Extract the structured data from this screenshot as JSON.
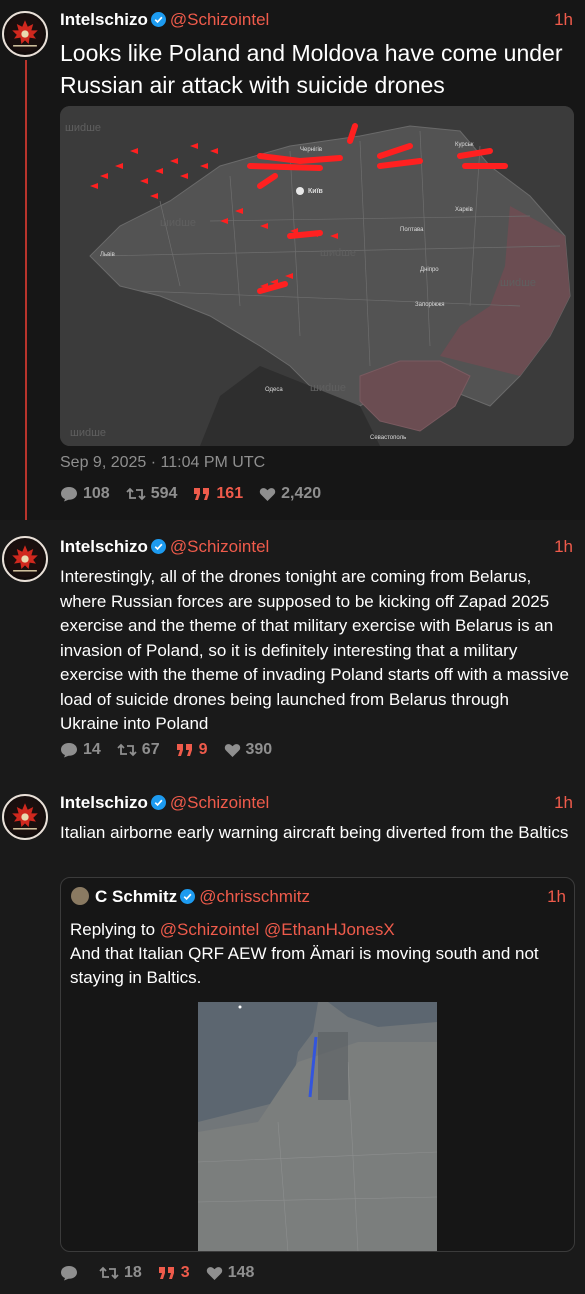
{
  "tweets": [
    {
      "author": "Intelschizo",
      "handle": "@Schizointel",
      "time": "1h",
      "text": "Looks like Poland and Moldova have come under Russian air attack with suicide drones",
      "date": "Sep 9, 2025 · 11:04 PM UTC",
      "replies": "108",
      "retweets": "594",
      "quotes": "161",
      "likes": "2,420"
    },
    {
      "author": "Intelschizo",
      "handle": "@Schizointel",
      "time": "1h",
      "text": "Interestingly, all of the drones tonight are coming from Belarus, where Russian forces are supposed to be kicking off Zapad 2025 exercise and the theme of that military exercise with Belarus is an invasion of Poland, so it is definitely interesting that a military exercise with the theme of invading Poland starts off with a massive load of suicide drones being launched from Belarus through Ukraine into Poland",
      "replies": "14",
      "retweets": "67",
      "quotes": "9",
      "likes": "390"
    },
    {
      "author": "Intelschizo",
      "handle": "@Schizointel",
      "time": "1h",
      "text": "Italian airborne early warning aircraft being diverted from the Baltics",
      "replies": "",
      "retweets": "18",
      "quotes": "3",
      "likes": "148"
    }
  ],
  "quoted": {
    "author": "C Schmitz",
    "handle": "@chrisschmitz",
    "time": "1h",
    "replying_label": "Replying to",
    "mention1": "@Schizointel",
    "mention2": "@EthanHJonesX",
    "text": "And that Italian QRF AEW from Ämari is moving south and not staying in Baltics."
  },
  "map": {
    "city_kyiv": "Київ",
    "city_kharkiv": "Харків",
    "city_odesa": "Одеса",
    "city_lviv": "Львів",
    "city_dnipro": "Дніпро",
    "city_zaporizhzhia": "Запоріжжя",
    "city_sevastopol": "Севастополь",
    "city_chernihiv": "Чернігів",
    "city_poltava": "Полтава",
    "city_kursk": "Курськ",
    "watermark": "шиdшe",
    "accent_drone": "#ff2020",
    "occupied_color": "#6b4d52"
  },
  "colors": {
    "accent": "#ef5b4b",
    "verified": "#1d9bf0",
    "background": "#161616",
    "muted": "#8f8f8f"
  }
}
